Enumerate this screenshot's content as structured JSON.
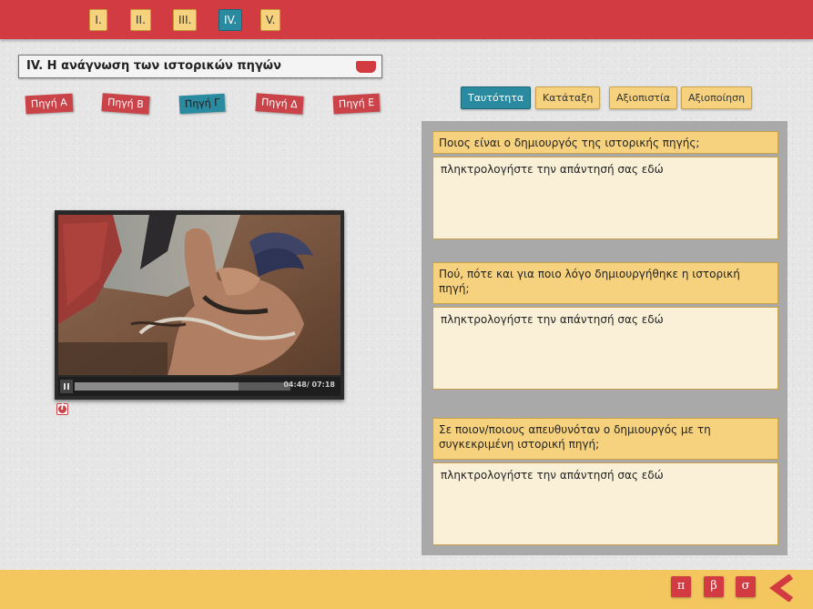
{
  "chapters": [
    {
      "label": "I.",
      "active": false
    },
    {
      "label": "II.",
      "active": false
    },
    {
      "label": "III.",
      "active": false
    },
    {
      "label": "IV.",
      "active": true
    },
    {
      "label": "V.",
      "active": false
    }
  ],
  "section": {
    "title": "IV. Η ανάγνωση των ιστορικών πηγών"
  },
  "sources": [
    {
      "label": "Πηγή Α",
      "active": false
    },
    {
      "label": "Πηγή Β",
      "active": false
    },
    {
      "label": "Πηγή Γ",
      "active": true
    },
    {
      "label": "Πηγή Δ",
      "active": false
    },
    {
      "label": "Πηγή Ε",
      "active": false
    }
  ],
  "video": {
    "time": "04:48/ 07:18",
    "progress": 0.76,
    "state": "playing"
  },
  "mode_tabs": [
    {
      "label": "Ταυτότητα",
      "active": true
    },
    {
      "label": "Κατάταξη",
      "active": false
    },
    {
      "label": "Αξιοπιστία",
      "active": false
    },
    {
      "label": "Αξιοποίηση",
      "active": false
    }
  ],
  "questions": [
    {
      "question": "Ποιος είναι ο δημιουργός της ιστορικής πηγής;",
      "placeholder": "πληκτρολογήστε την απάντησή σας εδώ"
    },
    {
      "question": "Πού, πότε και για ποιο λόγο δημιουργήθηκε η ιστορική πηγή;",
      "placeholder": "πληκτρολογήστε την απάντησή σας εδώ"
    },
    {
      "question": "Σε ποιον/ποιους απευθυνόταν ο δημιουργός με τη συγκεκριμένη ιστορική πηγή;",
      "placeholder": "πληκτρολογήστε την απάντησή σας εδώ"
    }
  ],
  "bottom_buttons": [
    {
      "label": "π",
      "icon": "pi"
    },
    {
      "label": "β",
      "icon": "beta"
    },
    {
      "label": "σ",
      "icon": "sigma"
    }
  ],
  "colors": {
    "red": "#d23b41",
    "yellow": "#f7d27e",
    "teal": "#2a8aa0",
    "panel": "#a9a9a9",
    "bottom": "#f3c65e"
  }
}
